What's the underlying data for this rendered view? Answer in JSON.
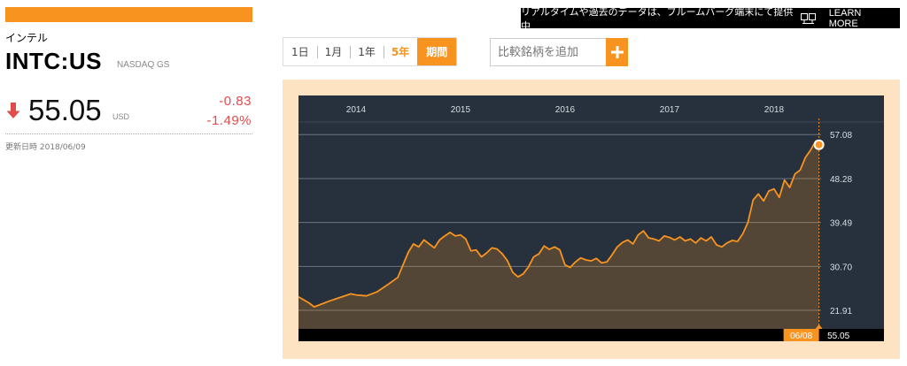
{
  "stock": {
    "name_jp": "インテル",
    "ticker": "INTC:US",
    "exchange": "NASDAQ GS",
    "price": "55.05",
    "currency": "USD",
    "change_abs": "-0.83",
    "change_pct": "-1.49%",
    "updated": "更新日時 2018/06/09"
  },
  "promo": {
    "text": "リアルタイムや過去のデータは、ブルームバーグ端末にて提供中",
    "learn_more": "LEARN MORE"
  },
  "ranges": [
    {
      "label": "1日"
    },
    {
      "label": "1月"
    },
    {
      "label": "1年"
    },
    {
      "label": "5年"
    },
    {
      "label": "期間"
    }
  ],
  "compare": {
    "placeholder": "比較銘柄を追加"
  },
  "colors": {
    "accent": "#f7931e",
    "chart_bg": "#27313d",
    "chart_frame": "#fde3c2",
    "negative": "#e24b4b"
  },
  "chart_data": {
    "type": "area",
    "x_ticks": [
      "2014",
      "2015",
      "2016",
      "2017",
      "2018"
    ],
    "y_ticks": [
      "57.08",
      "48.28",
      "39.49",
      "30.70",
      "21.91"
    ],
    "ylim": [
      18.2,
      59.6
    ],
    "xlim": [
      2013.45,
      2018.45
    ],
    "grid": true,
    "last_date": "06/08",
    "last_value": "55.05",
    "x": [
      2013.45,
      2013.55,
      2013.6,
      2013.65,
      2013.75,
      2013.85,
      2013.95,
      2014.0,
      2014.1,
      2014.2,
      2014.3,
      2014.4,
      2014.5,
      2014.55,
      2014.6,
      2014.65,
      2014.7,
      2014.75,
      2014.8,
      2014.85,
      2014.9,
      2014.95,
      2015.0,
      2015.05,
      2015.1,
      2015.15,
      2015.2,
      2015.25,
      2015.3,
      2015.35,
      2015.4,
      2015.45,
      2015.5,
      2015.55,
      2015.6,
      2015.65,
      2015.7,
      2015.75,
      2015.8,
      2015.85,
      2015.9,
      2015.95,
      2016.0,
      2016.05,
      2016.1,
      2016.15,
      2016.2,
      2016.25,
      2016.3,
      2016.35,
      2016.4,
      2016.45,
      2016.5,
      2016.55,
      2016.6,
      2016.65,
      2016.7,
      2016.75,
      2016.8,
      2016.85,
      2016.9,
      2016.95,
      2017.0,
      2017.05,
      2017.1,
      2017.15,
      2017.2,
      2017.25,
      2017.3,
      2017.35,
      2017.4,
      2017.45,
      2017.5,
      2017.55,
      2017.6,
      2017.65,
      2017.7,
      2017.75,
      2017.8,
      2017.85,
      2017.9,
      2017.95,
      2018.0,
      2018.05,
      2018.1,
      2018.15,
      2018.2,
      2018.25,
      2018.3,
      2018.35,
      2018.4,
      2018.43
    ],
    "values": [
      24.6,
      23.4,
      22.6,
      23.0,
      23.8,
      24.5,
      25.2,
      25.0,
      24.8,
      25.6,
      27.0,
      28.5,
      33.5,
      35.2,
      34.6,
      36.0,
      35.2,
      34.4,
      36.0,
      36.8,
      37.5,
      36.8,
      37.0,
      36.2,
      33.8,
      34.0,
      32.6,
      33.4,
      34.4,
      34.2,
      33.2,
      31.8,
      29.5,
      28.6,
      29.2,
      30.6,
      32.6,
      33.2,
      34.8,
      34.1,
      34.6,
      34.0,
      31.0,
      30.5,
      31.6,
      32.4,
      32.0,
      31.8,
      32.3,
      31.4,
      31.6,
      33.0,
      34.6,
      35.5,
      36.0,
      35.2,
      37.0,
      37.8,
      36.4,
      36.2,
      35.8,
      36.8,
      36.5,
      36.0,
      36.6,
      35.8,
      36.2,
      35.4,
      36.4,
      35.8,
      36.6,
      35.0,
      34.6,
      35.4,
      35.9,
      35.7,
      37.2,
      39.5,
      44.0,
      45.2,
      43.8,
      45.8,
      46.2,
      44.5,
      48.0,
      46.5,
      49.2,
      50.0,
      52.5,
      54.0,
      55.8,
      55.05
    ]
  }
}
